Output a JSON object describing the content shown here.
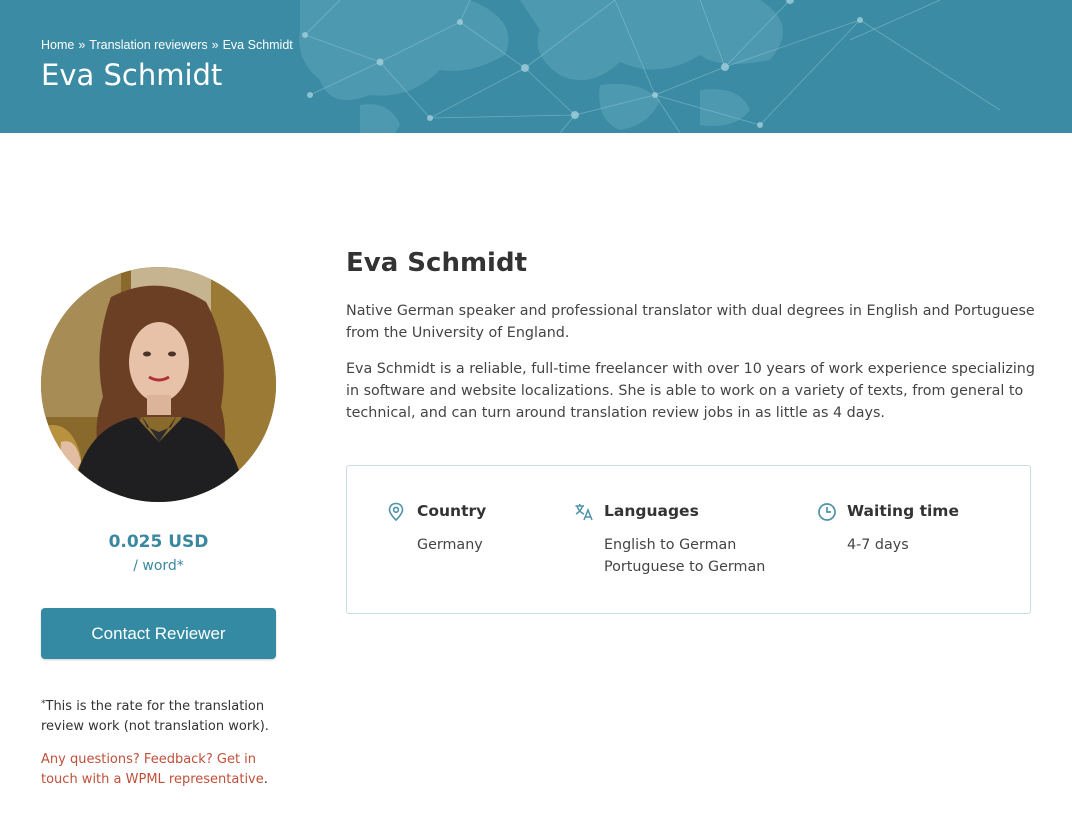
{
  "breadcrumb": {
    "home": "Home",
    "separator": "»",
    "section": "Translation reviewers",
    "current": "Eva Schmidt"
  },
  "hero": {
    "title": "Eva Schmidt"
  },
  "sidebar": {
    "price": "0.025 USD",
    "per_word": "/ word*",
    "contact_label": "Contact Reviewer",
    "footnote_mark": "*",
    "footnote_text": "This is the rate for the translation review work (not translation work).",
    "questions_link": "Any questions? Feedback? Get in touch with a WPML representative",
    "questions_end": "."
  },
  "profile": {
    "name": "Eva Schmidt",
    "bio_1": "Native German speaker and professional translator with dual degrees in English and Portuguese from the University of England.",
    "bio_2": "Eva Schmidt is a reliable, full-time freelancer with over 10 years of work experience specializing in software and website localizations. She is able to work on a variety of texts, from general to technical, and can turn around translation review jobs in as little as 4 days."
  },
  "info": {
    "country": {
      "label": "Country",
      "value": "Germany",
      "icon": "location-pin-icon"
    },
    "languages": {
      "label": "Languages",
      "values": [
        "English to German",
        "Portuguese to German"
      ],
      "icon": "translate-icon"
    },
    "waiting": {
      "label": "Waiting time",
      "value": "4-7 days",
      "icon": "clock-icon"
    }
  },
  "colors": {
    "header_bg": "#3a8ba3",
    "accent": "#338aa2",
    "link_red": "#c0503a"
  }
}
